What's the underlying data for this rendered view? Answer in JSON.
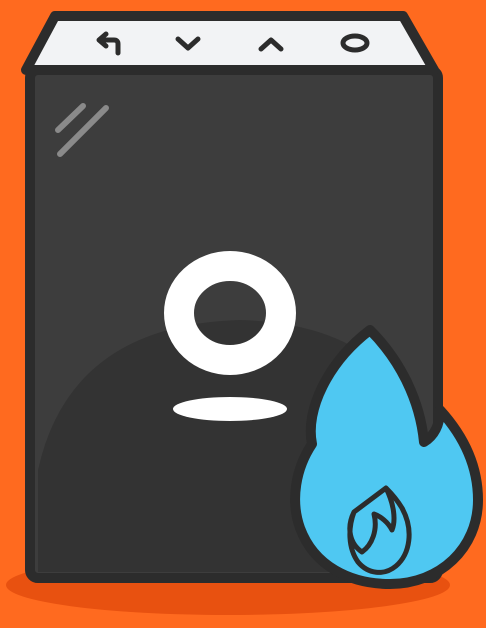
{
  "colors": {
    "background": "#ff6a1f",
    "shadow": "#e85110",
    "device_body": "#3d3d3d",
    "device_outline": "#2c2c2c",
    "top_panel": "#f2f3f5",
    "logo": "#ffffff",
    "flame_fill": "#4fc8f2",
    "flame_outline": "#2c2c2c"
  },
  "top_panel": {
    "buttons": [
      {
        "icon": "back-arrow-icon"
      },
      {
        "icon": "chevron-down-icon"
      },
      {
        "icon": "chevron-up-icon"
      },
      {
        "icon": "circle-button-icon"
      }
    ]
  },
  "device": {
    "logo_icon": "ring-logo-icon",
    "glare_icon": "glass-glare-icon"
  },
  "badge": {
    "icon": "flame-icon"
  }
}
